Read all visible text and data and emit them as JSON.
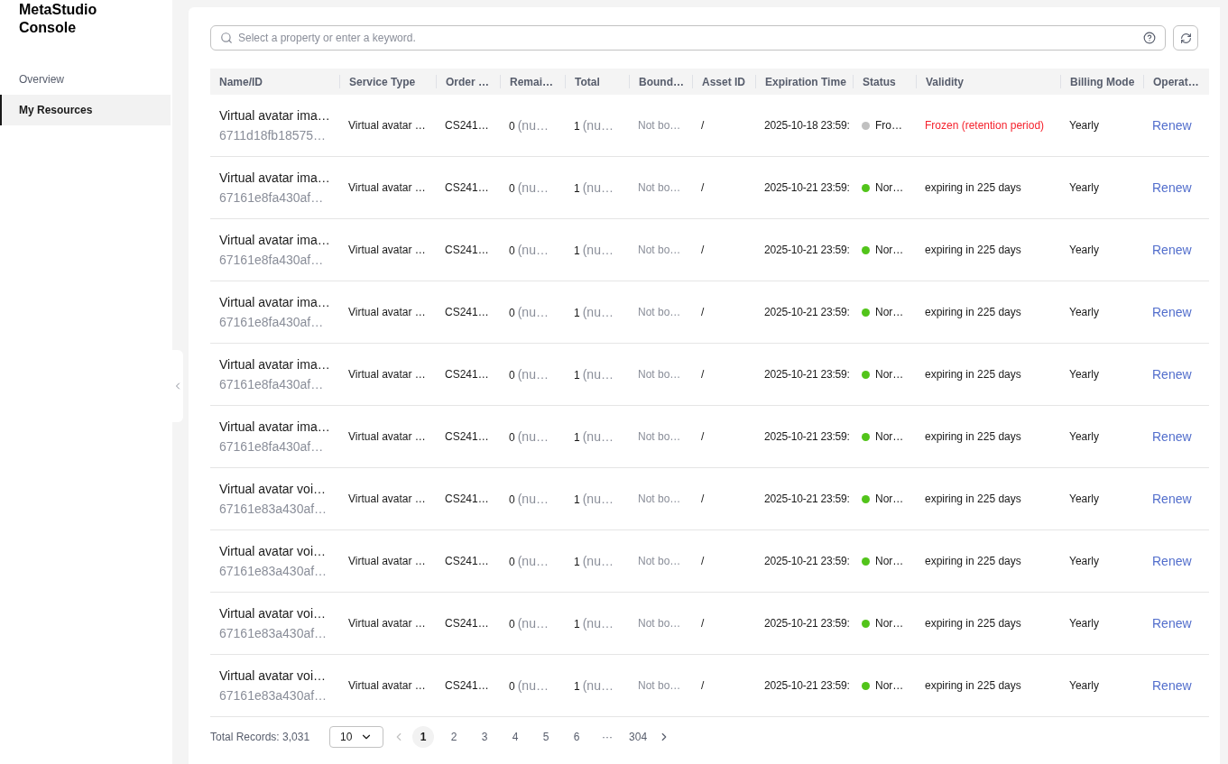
{
  "sidebar": {
    "title_line_1": "MetaStudio",
    "title_line_2": "Console",
    "items": [
      {
        "label": "Overview",
        "selected": false
      },
      {
        "label": "My Resources",
        "selected": true
      }
    ]
  },
  "search": {
    "placeholder": "Select a property or enter a keyword."
  },
  "table": {
    "columns": [
      "Name/ID",
      "Service Type",
      "Order …",
      "Remai…",
      "Total",
      "Bound…",
      "Asset ID",
      "Expiration Time",
      "Status",
      "Validity",
      "Billing Mode",
      "Operat…"
    ],
    "rows": [
      {
        "name": "Virtual avatar ima…",
        "id": "6711d18fb18575…",
        "service": "Virtual avatar …",
        "order": "CS241…",
        "remaining": "0",
        "remaining_unit": "(nu…",
        "total": "1",
        "total_unit": "(nu…",
        "bound": "Not bo…",
        "asset": "/",
        "expiration": "2025-10-18 23:59:",
        "status": "Fro…",
        "kind": "frozen",
        "color": "#c0c0c0",
        "validity": "Frozen (retention period)",
        "billing": "Yearly",
        "operation": "Renew"
      },
      {
        "name": "Virtual avatar ima…",
        "id": "67161e8fa430af…",
        "service": "Virtual avatar …",
        "order": "CS241…",
        "remaining": "0",
        "remaining_unit": "(nu…",
        "total": "1",
        "total_unit": "(nu…",
        "bound": "Not bo…",
        "asset": "/",
        "expiration": "2025-10-21 23:59:",
        "status": "Nor…",
        "kind": "normal",
        "color": "#52c41a",
        "validity": "expiring in 225 days",
        "billing": "Yearly",
        "operation": "Renew"
      },
      {
        "name": "Virtual avatar ima…",
        "id": "67161e8fa430af…",
        "service": "Virtual avatar …",
        "order": "CS241…",
        "remaining": "0",
        "remaining_unit": "(nu…",
        "total": "1",
        "total_unit": "(nu…",
        "bound": "Not bo…",
        "asset": "/",
        "expiration": "2025-10-21 23:59:",
        "status": "Nor…",
        "kind": "normal",
        "color": "#52c41a",
        "validity": "expiring in 225 days",
        "billing": "Yearly",
        "operation": "Renew"
      },
      {
        "name": "Virtual avatar ima…",
        "id": "67161e8fa430af…",
        "service": "Virtual avatar …",
        "order": "CS241…",
        "remaining": "0",
        "remaining_unit": "(nu…",
        "total": "1",
        "total_unit": "(nu…",
        "bound": "Not bo…",
        "asset": "/",
        "expiration": "2025-10-21 23:59:",
        "status": "Nor…",
        "kind": "normal",
        "color": "#52c41a",
        "validity": "expiring in 225 days",
        "billing": "Yearly",
        "operation": "Renew"
      },
      {
        "name": "Virtual avatar ima…",
        "id": "67161e8fa430af…",
        "service": "Virtual avatar …",
        "order": "CS241…",
        "remaining": "0",
        "remaining_unit": "(nu…",
        "total": "1",
        "total_unit": "(nu…",
        "bound": "Not bo…",
        "asset": "/",
        "expiration": "2025-10-21 23:59:",
        "status": "Nor…",
        "kind": "normal",
        "color": "#52c41a",
        "validity": "expiring in 225 days",
        "billing": "Yearly",
        "operation": "Renew"
      },
      {
        "name": "Virtual avatar ima…",
        "id": "67161e8fa430af…",
        "service": "Virtual avatar …",
        "order": "CS241…",
        "remaining": "0",
        "remaining_unit": "(nu…",
        "total": "1",
        "total_unit": "(nu…",
        "bound": "Not bo…",
        "asset": "/",
        "expiration": "2025-10-21 23:59:",
        "status": "Nor…",
        "kind": "normal",
        "color": "#52c41a",
        "validity": "expiring in 225 days",
        "billing": "Yearly",
        "operation": "Renew"
      },
      {
        "name": "Virtual avatar voi…",
        "id": "67161e83a430af…",
        "service": "Virtual avatar …",
        "order": "CS241…",
        "remaining": "0",
        "remaining_unit": "(nu…",
        "total": "1",
        "total_unit": "(nu…",
        "bound": "Not bo…",
        "asset": "/",
        "expiration": "2025-10-21 23:59:",
        "status": "Nor…",
        "kind": "normal",
        "color": "#52c41a",
        "validity": "expiring in 225 days",
        "billing": "Yearly",
        "operation": "Renew"
      },
      {
        "name": "Virtual avatar voi…",
        "id": "67161e83a430af…",
        "service": "Virtual avatar …",
        "order": "CS241…",
        "remaining": "0",
        "remaining_unit": "(nu…",
        "total": "1",
        "total_unit": "(nu…",
        "bound": "Not bo…",
        "asset": "/",
        "expiration": "2025-10-21 23:59:",
        "status": "Nor…",
        "kind": "normal",
        "color": "#52c41a",
        "validity": "expiring in 225 days",
        "billing": "Yearly",
        "operation": "Renew"
      },
      {
        "name": "Virtual avatar voi…",
        "id": "67161e83a430af…",
        "service": "Virtual avatar …",
        "order": "CS241…",
        "remaining": "0",
        "remaining_unit": "(nu…",
        "total": "1",
        "total_unit": "(nu…",
        "bound": "Not bo…",
        "asset": "/",
        "expiration": "2025-10-21 23:59:",
        "status": "Nor…",
        "kind": "normal",
        "color": "#52c41a",
        "validity": "expiring in 225 days",
        "billing": "Yearly",
        "operation": "Renew"
      },
      {
        "name": "Virtual avatar voi…",
        "id": "67161e83a430af…",
        "service": "Virtual avatar …",
        "order": "CS241…",
        "remaining": "0",
        "remaining_unit": "(nu…",
        "total": "1",
        "total_unit": "(nu…",
        "bound": "Not bo…",
        "asset": "/",
        "expiration": "2025-10-21 23:59:",
        "status": "Nor…",
        "kind": "normal",
        "color": "#52c41a",
        "validity": "expiring in 225 days",
        "billing": "Yearly",
        "operation": "Renew"
      }
    ]
  },
  "pagination": {
    "total": "Total Records: 3,031",
    "page_size": "10",
    "pages": [
      {
        "label": "1",
        "selected": true
      },
      {
        "label": "2",
        "selected": false
      },
      {
        "label": "3",
        "selected": false
      },
      {
        "label": "4",
        "selected": false
      },
      {
        "label": "5",
        "selected": false
      },
      {
        "label": "6",
        "selected": false
      },
      {
        "label": "···",
        "selected": false
      },
      {
        "label": "304",
        "selected": false
      }
    ]
  }
}
